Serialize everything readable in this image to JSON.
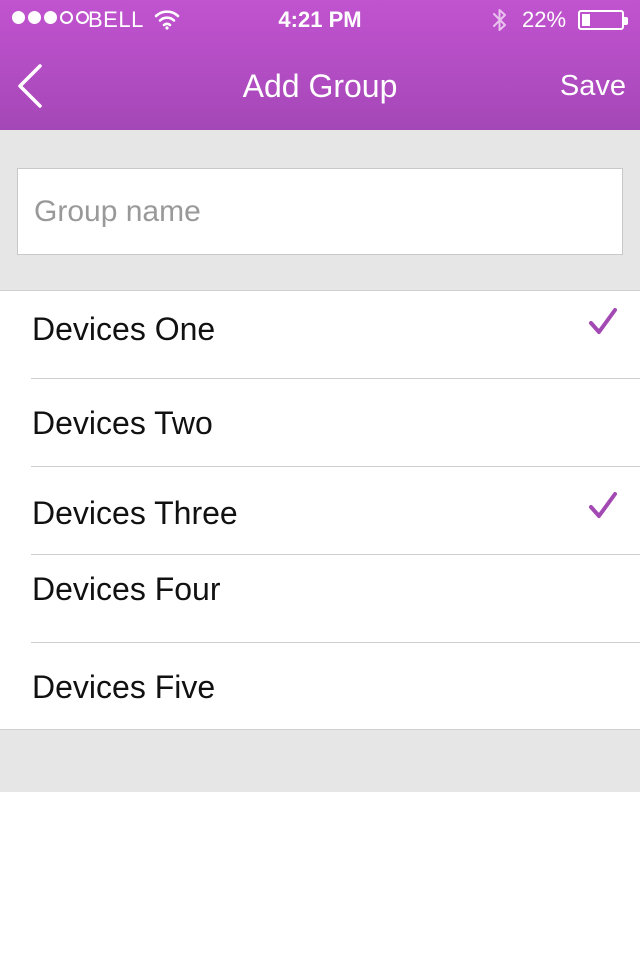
{
  "status_bar": {
    "signal_icon": "cell-signal-dots",
    "signal_strength": 3,
    "signal_max": 5,
    "carrier": "BELL",
    "wifi_icon": "wifi-icon",
    "time": "4:21 PM",
    "bluetooth_icon": "bluetooth-icon",
    "battery_percent": "22%",
    "battery_level": 0.22
  },
  "nav": {
    "back_icon": "chevron-left-icon",
    "title": "Add Group",
    "save_label": "Save"
  },
  "form": {
    "group_name_value": "",
    "group_name_placeholder": "Group name"
  },
  "devices": [
    {
      "label": "Devices One",
      "checked": true
    },
    {
      "label": "Devices Two",
      "checked": false
    },
    {
      "label": "Devices Three",
      "checked": true
    },
    {
      "label": "Devices Four",
      "checked": false
    },
    {
      "label": "Devices Five",
      "checked": false
    }
  ],
  "colors": {
    "header_top": "#c153cf",
    "header_bottom": "#a447b6",
    "checkmark": "#a349b4",
    "band": "#e6e6e6"
  }
}
